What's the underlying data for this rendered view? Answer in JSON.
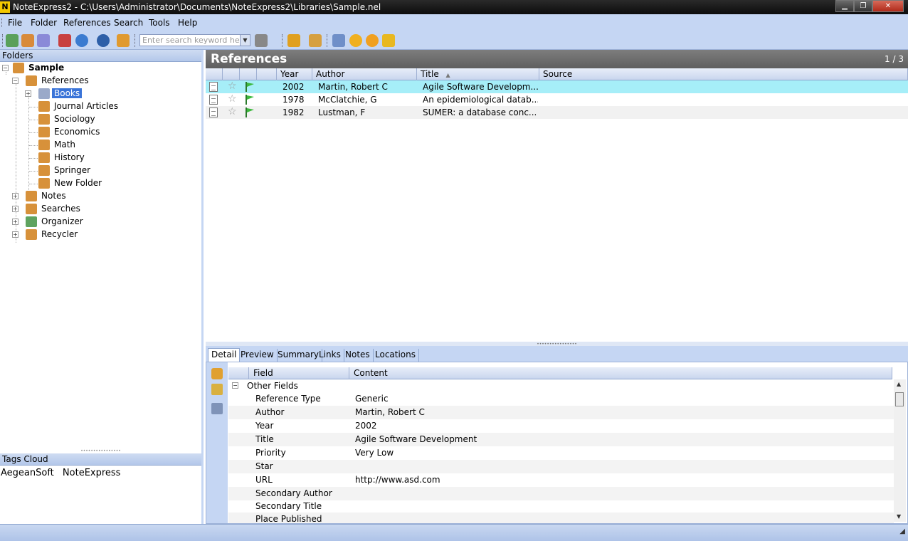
{
  "window": {
    "title": "NoteExpress2 - C:\\Users\\Administrator\\Documents\\NoteExpress2\\Libraries\\Sample.nel",
    "app_icon_letter": "N"
  },
  "menu": [
    "File",
    "Folder",
    "References",
    "Search",
    "Tools",
    "Help"
  ],
  "toolbar": {
    "search_placeholder": "Enter search keyword here"
  },
  "left_pane": {
    "header": "Folders",
    "tree": {
      "root": "Sample",
      "references": "References",
      "books": "Books",
      "subfolders": [
        "Journal Articles",
        "Sociology",
        "Economics",
        "Math",
        "History",
        "Springer",
        "New Folder"
      ],
      "top_level": [
        "Notes",
        "Searches",
        "Organizer",
        "Recycler"
      ]
    },
    "tags_header": "Tags Cloud",
    "tags": [
      "AegeanSoft",
      "NoteExpress"
    ]
  },
  "references_panel": {
    "title": "References",
    "page": "1 / 3",
    "columns": [
      "Year",
      "Author",
      "Title",
      "Source"
    ],
    "rows": [
      {
        "year": "2002",
        "author": "Martin, Robert C",
        "title": "Agile Software Developm...",
        "source": "",
        "selected": true
      },
      {
        "year": "1978",
        "author": "McClatchie, G",
        "title": "An epidemiological datab...",
        "source": "",
        "selected": false
      },
      {
        "year": "1982",
        "author": "Lustman, F",
        "title": "SUMER: a database conc...",
        "source": "",
        "selected": false
      }
    ]
  },
  "detail": {
    "tabs": [
      "Detail",
      "Preview",
      "Summary",
      "Links",
      "Notes",
      "Locations"
    ],
    "active_tab": "Detail",
    "columns": [
      "Field",
      "Content"
    ],
    "group": "Other Fields",
    "fields": [
      {
        "field": "Reference Type",
        "content": "Generic"
      },
      {
        "field": "Author",
        "content": "Martin, Robert C"
      },
      {
        "field": "Year",
        "content": "2002"
      },
      {
        "field": "Title",
        "content": "Agile Software Development"
      },
      {
        "field": "Priority",
        "content": "Very Low"
      },
      {
        "field": "Star",
        "content": ""
      },
      {
        "field": "URL",
        "content": "http://www.asd.com"
      },
      {
        "field": "Secondary Author",
        "content": ""
      },
      {
        "field": "Secondary Title",
        "content": ""
      },
      {
        "field": "Place Published",
        "content": ""
      }
    ]
  },
  "colors": {
    "chrome": "#c5d6f3",
    "selected_row": "#a6eef8",
    "tree_selection": "#3a74d8"
  }
}
